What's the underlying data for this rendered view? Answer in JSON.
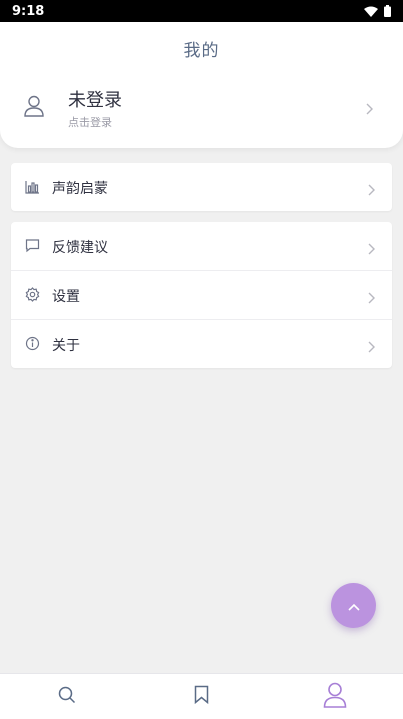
{
  "status_bar": {
    "time": "9:18",
    "icons": [
      "wifi-icon",
      "battery-icon"
    ]
  },
  "header": {
    "title": "我的"
  },
  "login": {
    "title": "未登录",
    "subtitle": "点击登录",
    "icon": "user-icon"
  },
  "menu_groups": [
    {
      "items": [
        {
          "label": "声韵启蒙",
          "icon": "bar-chart-icon"
        }
      ]
    },
    {
      "items": [
        {
          "label": "反馈建议",
          "icon": "comment-icon"
        },
        {
          "label": "设置",
          "icon": "gear-icon"
        },
        {
          "label": "关于",
          "icon": "info-icon"
        }
      ]
    }
  ],
  "fab": {
    "icon": "chevron-up-icon"
  },
  "bottom_nav": {
    "items": [
      {
        "name": "search",
        "icon": "search-icon",
        "active": false
      },
      {
        "name": "bookmark",
        "icon": "bookmark-icon",
        "active": false
      },
      {
        "name": "profile",
        "icon": "user-icon",
        "active": true
      }
    ]
  },
  "colors": {
    "accent": "#bb93df",
    "active_nav": "#a77fd6",
    "inactive_nav": "#5a6b86",
    "background": "#f0f0f0"
  }
}
